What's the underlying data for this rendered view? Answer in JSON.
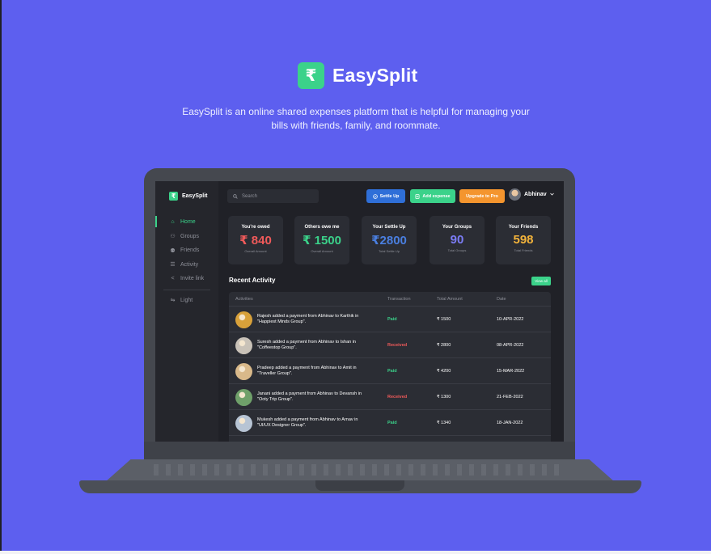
{
  "hero": {
    "logo_glyph": "₹",
    "title": "EasySplit",
    "description": "EasySplit is an online shared expenses platform that is helpful for managing your bills with friends, family, and roommate."
  },
  "app": {
    "brand": {
      "glyph": "₹",
      "name": "EasySplit"
    },
    "nav": [
      {
        "label": "Home",
        "icon": "home-icon",
        "glyph": "⌂",
        "active": true
      },
      {
        "label": "Groups",
        "icon": "groups-icon",
        "glyph": "⚇",
        "active": false
      },
      {
        "label": "Friends",
        "icon": "friends-icon",
        "glyph": "⚉",
        "active": false
      },
      {
        "label": "Activity",
        "icon": "activity-icon",
        "glyph": "☰",
        "active": false
      },
      {
        "label": "Invite link",
        "icon": "share-icon",
        "glyph": "<",
        "active": false
      }
    ],
    "theme_toggle": {
      "label": "Light",
      "icon": "toggle-icon",
      "glyph": "⇋"
    },
    "search": {
      "placeholder": "Search",
      "icon": "search-icon"
    },
    "buttons": {
      "settle_up": "Settle Up",
      "add_expense": "Add expense",
      "upgrade": "Upgrade to Pro"
    },
    "user": {
      "name": "Abhinav",
      "icon": "chevron-down-icon"
    },
    "stats": [
      {
        "title": "You're owed",
        "value": "₹ 840",
        "sub": "Overall Amount",
        "color": "#f05a5a"
      },
      {
        "title": "Others owe me",
        "value": "₹ 1500",
        "sub": "Overall Amount",
        "color": "#3bd28a"
      },
      {
        "title": "Your Settle Up",
        "value": "₹2800",
        "sub": "Total Settle Up",
        "color": "#4a7fe0"
      },
      {
        "title": "Your Groups",
        "value": "90",
        "sub": "Total Groups",
        "color": "#7b7cf5"
      },
      {
        "title": "Your Friends",
        "value": "598",
        "sub": "Total Friends",
        "color": "#f4b43b"
      }
    ],
    "recent_activity": {
      "title": "Recent Activity",
      "view_all": "View all",
      "columns": [
        "Activities",
        "Transaction",
        "Total Amount",
        "Date"
      ],
      "rows": [
        {
          "text": "Rajesh added a payment from Abhinav to Karthik in \"Happiest Minds Group\".",
          "status": "Paid",
          "status_color": "#3bd28a",
          "amount": "₹ 1500",
          "date": "10-APR-2022",
          "avatar_color": "#d8a13a"
        },
        {
          "text": "Suresh added a payment from Abhinav to Ishan in \"Coffeestop Group\".",
          "status": "Received",
          "status_color": "#f05a5a",
          "amount": "₹ 2800",
          "date": "08-APR-2022",
          "avatar_color": "#c9c2b8"
        },
        {
          "text": "Pradeep added a payment from Abhinav to Amit in \"Traveller Group\".",
          "status": "Paid",
          "status_color": "#3bd28a",
          "amount": "₹ 4200",
          "date": "15-MAR-2022",
          "avatar_color": "#d9b98a"
        },
        {
          "text": "Janani added a payment from Abhinav to Devansh in \"Ooty Trip Group\".",
          "status": "Received",
          "status_color": "#f05a5a",
          "amount": "₹ 1300",
          "date": "21-FEB-2022",
          "avatar_color": "#6fa06a"
        },
        {
          "text": "Mukesh added a payment from Abhinav to Arnav in \"UI/UX Designer Group\".",
          "status": "Paid",
          "status_color": "#3bd28a",
          "amount": "₹ 1340",
          "date": "18-JAN-2022",
          "avatar_color": "#b7c4d4"
        }
      ]
    }
  }
}
